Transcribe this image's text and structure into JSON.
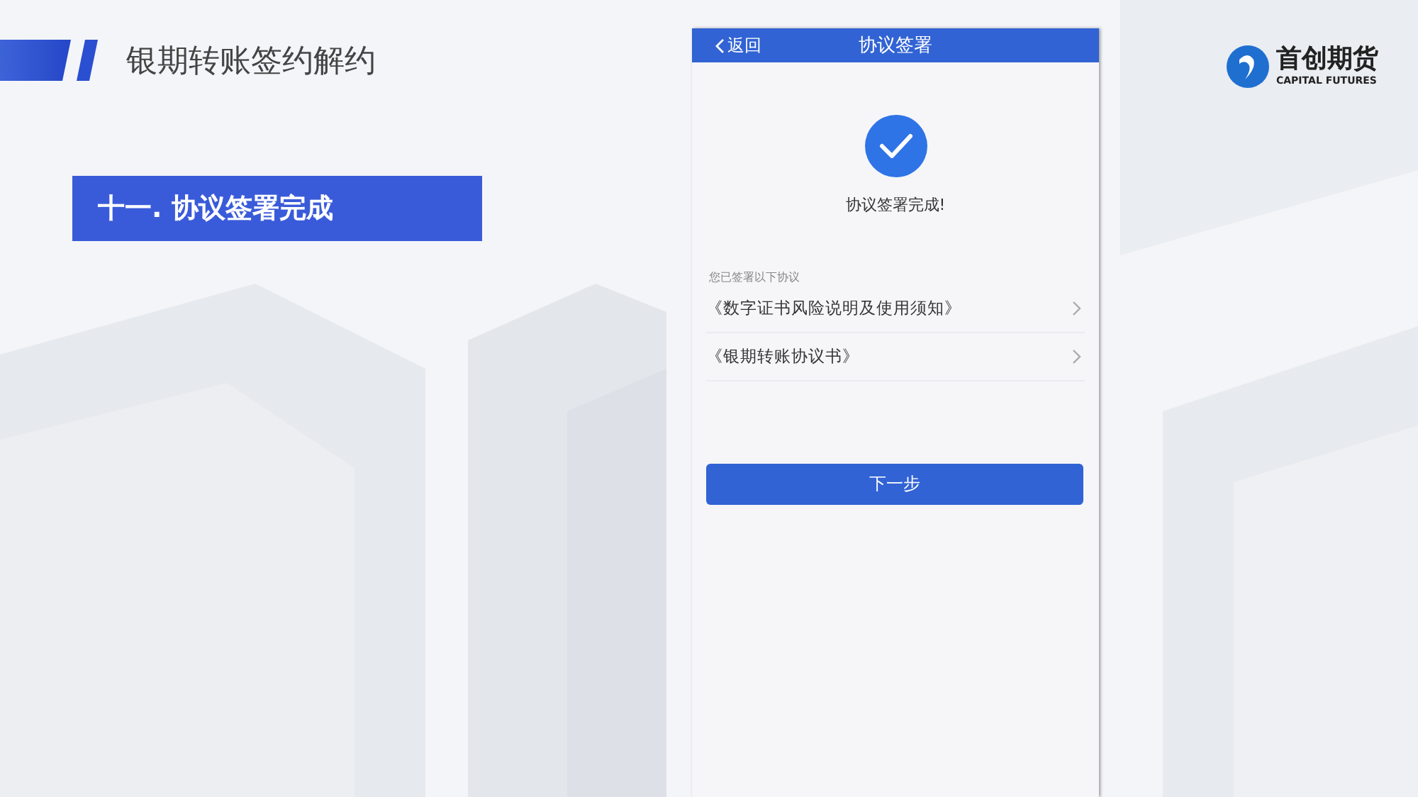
{
  "slide": {
    "title": "银期转账签约解约",
    "section": "十一. 协议签署完成"
  },
  "logo": {
    "name": "首创期货",
    "subtitle": "CAPITAL FUTURES"
  },
  "phone": {
    "back": "返回",
    "title": "协议签署",
    "status": "协议签署完成!",
    "list_heading": "您已签署以下协议",
    "agreements": [
      {
        "title": "《数字证书风险说明及使用须知》"
      },
      {
        "title": "《银期转账协议书》"
      }
    ],
    "button": "下一步"
  }
}
